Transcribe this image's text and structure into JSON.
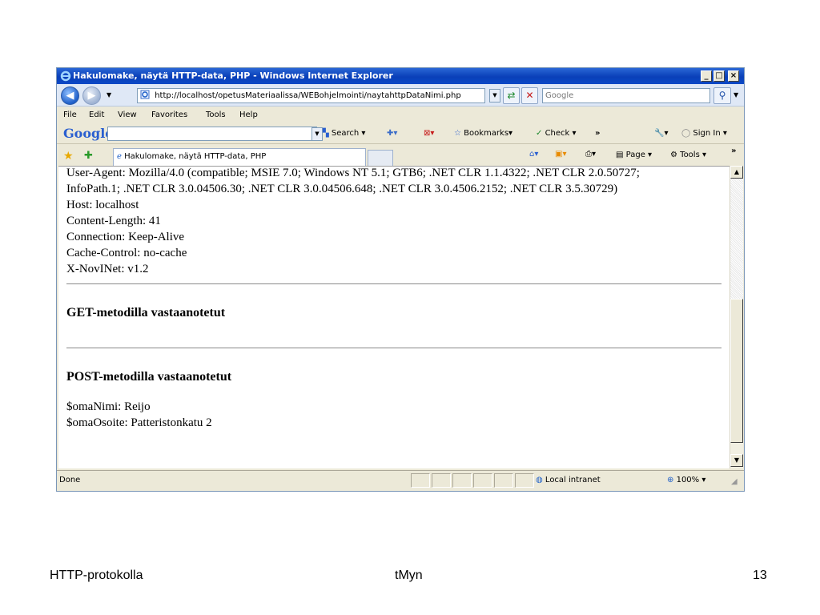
{
  "window": {
    "title": "Hakulomake, näytä HTTP-data, PHP - Windows Internet Explorer",
    "minimize": "_",
    "maximize": "□",
    "close": "×"
  },
  "address": {
    "url": "http://localhost/opetusMateriaalissa/WEBohjelmointi/naytahttpDataNimi.php",
    "search_placeholder": "Google"
  },
  "menu": [
    "File",
    "Edit",
    "View",
    "Favorites",
    "Tools",
    "Help"
  ],
  "google_toolbar": {
    "logo": "Google",
    "search_label": "Search",
    "bookmarks_label": "Bookmarks",
    "check_label": "Check",
    "more": "»",
    "sign_in": "Sign In"
  },
  "tab": {
    "title": "Hakulomake, näytä HTTP-data, PHP",
    "page_menu": "Page",
    "tools_menu": "Tools"
  },
  "content": {
    "headers": [
      "User-Agent: Mozilla/4.0 (compatible; MSIE 7.0; Windows NT 5.1; GTB6; .NET CLR 1.1.4322; .NET CLR 2.0.50727;",
      "InfoPath.1; .NET CLR 3.0.04506.30; .NET CLR 3.0.04506.648; .NET CLR 3.0.4506.2152; .NET CLR 3.5.30729)",
      "Host: localhost",
      "Content-Length: 41",
      "Connection: Keep-Alive",
      "Cache-Control: no-cache",
      "X-NovINet: v1.2"
    ],
    "get_heading": "GET-metodilla vastaanotetut",
    "post_heading": "POST-metodilla vastaanotetut",
    "post_values": [
      "$omaNimi: Reijo",
      "$omaOsoite: Patteristonkatu 2"
    ]
  },
  "status": {
    "text": "Done",
    "zone": "Local intranet",
    "zoom": "100%"
  },
  "slide_footer": {
    "left": "HTTP-protokolla",
    "center": "tMyn",
    "page_number": "13"
  }
}
